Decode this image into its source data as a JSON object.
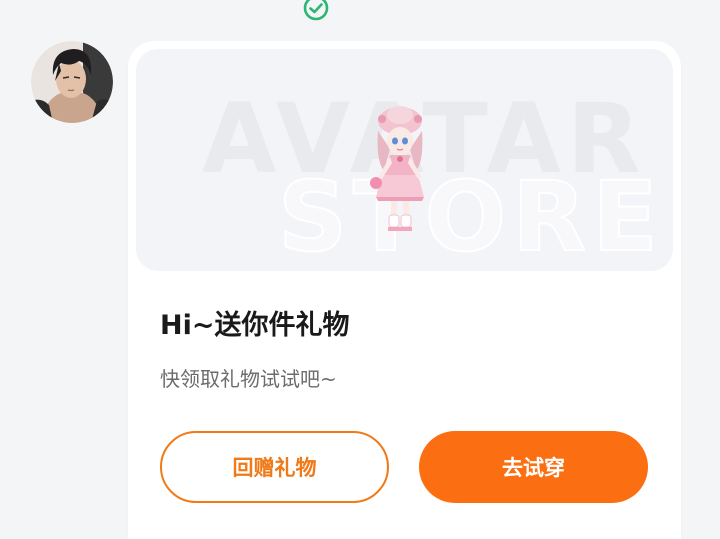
{
  "colors": {
    "accent": "#fb6f12",
    "outline": "#f07a18",
    "check": "#2bb673",
    "card_bg": "#ffffff",
    "page_bg": "#f4f5f7"
  },
  "icons": {
    "top": "check-circle-icon",
    "avatar": "user-avatar"
  },
  "banner": {
    "watermark_line1": "AVATAR",
    "watermark_line2": "STORE"
  },
  "message": {
    "title": "Hi~送你件礼物",
    "subtitle": "快领取礼物试试吧~"
  },
  "actions": {
    "return_gift_label": "回赠礼物",
    "try_on_label": "去试穿"
  }
}
